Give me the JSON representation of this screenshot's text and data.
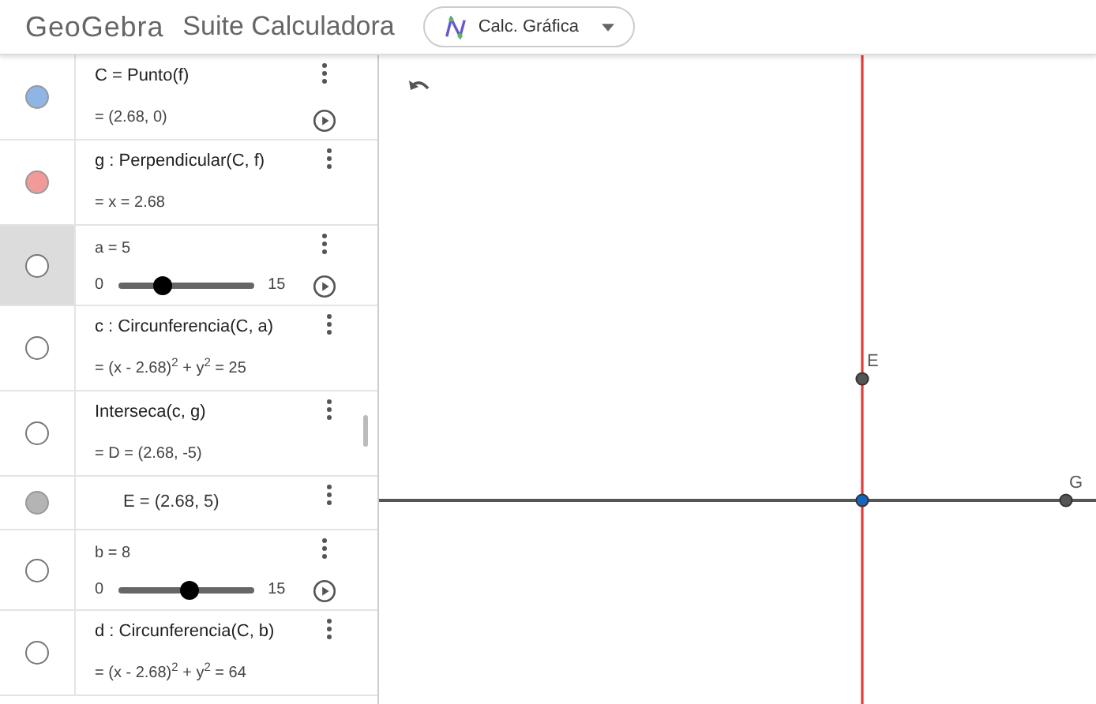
{
  "header": {
    "logo": "GeoGebra",
    "title": "Suite Calculadora",
    "app_selector": "Calc. Gráfica"
  },
  "algebra": [
    {
      "kind": "expression",
      "visible": true,
      "color": "#8fb4e6",
      "selected": false,
      "lines": [
        "C = Punto(f)",
        "= (2.68, 0)"
      ],
      "play": true
    },
    {
      "kind": "expression",
      "visible": true,
      "color": "#f29a9a",
      "selected": false,
      "lines": [
        "g : Perpendicular(C, f)",
        "= x = 2.68"
      ],
      "play": false
    },
    {
      "kind": "slider",
      "visible": false,
      "selected": true,
      "lines": [
        "a = 5"
      ],
      "min": "0",
      "max": "15",
      "level": 0.33,
      "play": true
    },
    {
      "kind": "expression",
      "visible": false,
      "selected": false,
      "lines": [
        "c : Circunferencia(C, a)",
        "= (x - 2.68)$^{2}$ + y$^{2}$ = 25"
      ],
      "play": false
    },
    {
      "kind": "expression",
      "visible": false,
      "selected": false,
      "lines": [
        "Interseca(c, g)",
        "= D = (2.68, -5)"
      ],
      "play": false
    },
    {
      "kind": "sub",
      "visible": true,
      "color": "#b4b4b4",
      "selected": false,
      "lines": [
        "E = (2.68, 5)"
      ],
      "play": false
    },
    {
      "kind": "slider",
      "visible": false,
      "selected": false,
      "lines": [
        "b = 8"
      ],
      "min": "0",
      "max": "15",
      "level": 0.53,
      "play": true
    },
    {
      "kind": "expression",
      "visible": false,
      "selected": false,
      "lines": [
        "d : Circunferencia(C, b)",
        "= (x - 2.68)$^{2}$ + y$^{2}$ = 64"
      ],
      "play": false
    }
  ],
  "canvas": {
    "points": [
      {
        "label": "E"
      },
      {
        "label": "G"
      }
    ]
  }
}
